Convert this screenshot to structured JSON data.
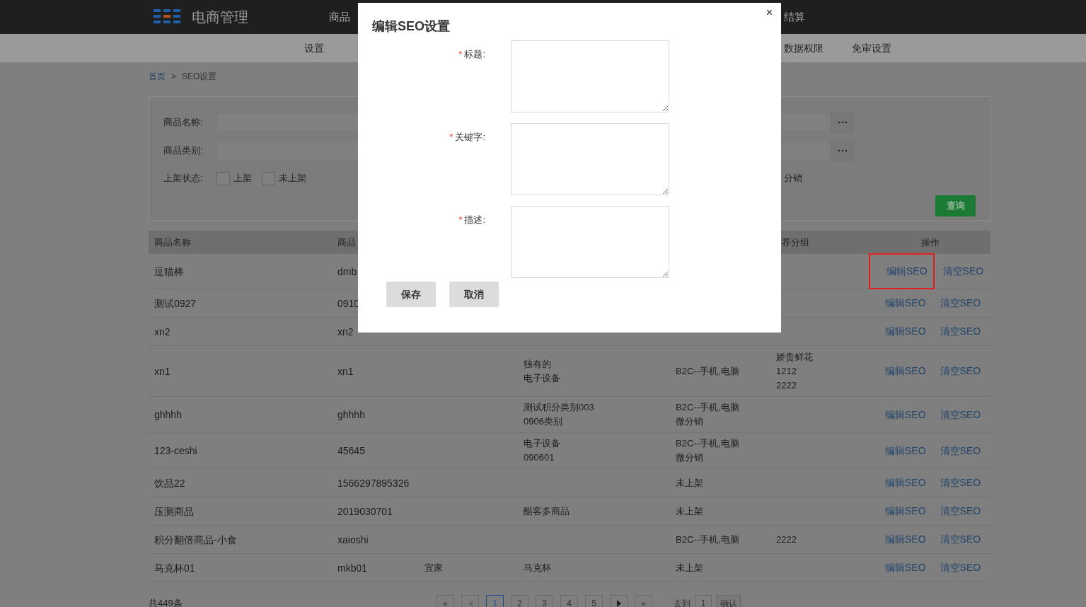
{
  "header": {
    "brand": "电商管理",
    "nav": [
      "商品",
      "结算"
    ]
  },
  "subnav": [
    "设置",
    "数据权限",
    "免审设置"
  ],
  "breadcrumb": {
    "home": "首页",
    "separator": ">",
    "current": "SEO设置"
  },
  "filters": {
    "fields": [
      {
        "label": "商品名称:"
      },
      {
        "label": "商品类别:"
      }
    ],
    "status_label": "上架状态:",
    "status_options": [
      {
        "label": "上架",
        "checked": false
      },
      {
        "label": "未上架",
        "checked": false
      }
    ],
    "channel_option": {
      "label": "分销"
    },
    "query_button": "查询"
  },
  "table": {
    "columns": [
      "商品名称",
      "商品",
      "",
      "",
      "",
      "荐分组",
      "操作"
    ],
    "rows": [
      {
        "cells": [
          [
            "逗猫棒"
          ],
          [
            "dmb"
          ],
          [],
          [],
          [],
          []
        ],
        "actions": [
          {
            "label": "编辑SEO",
            "highlighted": true
          },
          {
            "label": "清空SEO",
            "highlighted": false
          }
        ]
      },
      {
        "cells": [
          [
            "测试0927"
          ],
          [
            "0910"
          ],
          [],
          [],
          [],
          []
        ],
        "actions": [
          {
            "label": "编辑SEO",
            "highlighted": false
          },
          {
            "label": "清空SEO",
            "highlighted": false
          }
        ]
      },
      {
        "cells": [
          [
            "xn2"
          ],
          [
            "xn2"
          ],
          [],
          [],
          [],
          []
        ],
        "actions": [
          {
            "label": "编辑SEO",
            "highlighted": false
          },
          {
            "label": "清空SEO",
            "highlighted": false
          }
        ]
      },
      {
        "cells": [
          [
            "xn1"
          ],
          [
            "xn1"
          ],
          [],
          [
            "独有的",
            "电子设备"
          ],
          [
            "B2C--手机,电脑"
          ],
          [
            "娇贵鲜花",
            "1212",
            "2222"
          ]
        ],
        "actions": [
          {
            "label": "编辑SEO",
            "highlighted": false
          },
          {
            "label": "清空SEO",
            "highlighted": false
          }
        ]
      },
      {
        "cells": [
          [
            "ghhhh"
          ],
          [
            "ghhhh"
          ],
          [],
          [
            "测试积分类别003",
            "0906类别"
          ],
          [
            "B2C--手机,电脑",
            "微分销"
          ],
          []
        ],
        "actions": [
          {
            "label": "编辑SEO",
            "highlighted": false
          },
          {
            "label": "清空SEO",
            "highlighted": false
          }
        ]
      },
      {
        "cells": [
          [
            "123-ceshi"
          ],
          [
            "45645"
          ],
          [],
          [
            "电子设备",
            "090601"
          ],
          [
            "B2C--手机,电脑",
            "微分销"
          ],
          []
        ],
        "actions": [
          {
            "label": "编辑SEO",
            "highlighted": false
          },
          {
            "label": "清空SEO",
            "highlighted": false
          }
        ]
      },
      {
        "cells": [
          [
            "饮品22"
          ],
          [
            "1566297895326"
          ],
          [],
          [],
          [
            "未上架"
          ],
          []
        ],
        "actions": [
          {
            "label": "编辑SEO",
            "highlighted": false
          },
          {
            "label": "清空SEO",
            "highlighted": false
          }
        ]
      },
      {
        "cells": [
          [
            "压测商品"
          ],
          [
            "2019030701"
          ],
          [],
          [
            "酷客多商品"
          ],
          [
            "未上架"
          ],
          []
        ],
        "actions": [
          {
            "label": "编辑SEO",
            "highlighted": false
          },
          {
            "label": "清空SEO",
            "highlighted": false
          }
        ]
      },
      {
        "cells": [
          [
            "积分翻倍商品-小食"
          ],
          [
            "xaioshi"
          ],
          [],
          [],
          [
            "B2C--手机,电脑"
          ],
          [
            "2222"
          ]
        ],
        "actions": [
          {
            "label": "编辑SEO",
            "highlighted": false
          },
          {
            "label": "清空SEO",
            "highlighted": false
          }
        ]
      },
      {
        "cells": [
          [
            "马克杯01"
          ],
          [
            "mkb01"
          ],
          [
            "宜家"
          ],
          [
            "马克杯"
          ],
          [
            "未上架"
          ],
          []
        ],
        "actions": [
          {
            "label": "编辑SEO",
            "highlighted": false
          },
          {
            "label": "清空SEO",
            "highlighted": false
          }
        ]
      }
    ]
  },
  "pagination": {
    "total": "共449条",
    "first": "«",
    "pages": [
      {
        "label": "1",
        "selected": true
      },
      {
        "label": "2",
        "selected": false
      },
      {
        "label": "3",
        "selected": false
      },
      {
        "label": "4",
        "selected": false
      },
      {
        "label": "5",
        "selected": false
      }
    ],
    "last": "»",
    "goto_label": "去到",
    "goto_value": "1",
    "confirm": "确认"
  },
  "dialog": {
    "title": "编辑SEO设置",
    "close": "×",
    "required_mark": "*",
    "fields": [
      {
        "label": "标题:",
        "required": true
      },
      {
        "label": "关键字:",
        "required": true
      },
      {
        "label": "描述:",
        "required": true
      }
    ],
    "buttons": [
      "保存",
      "取消"
    ]
  }
}
